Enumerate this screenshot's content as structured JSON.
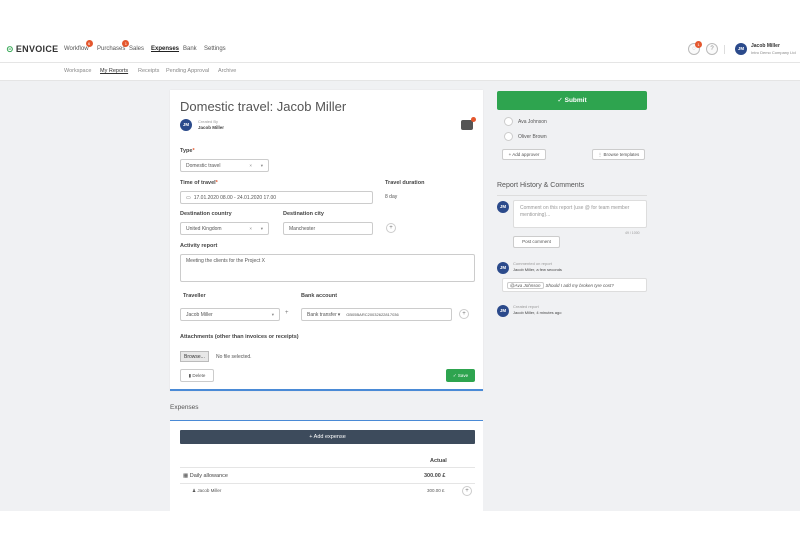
{
  "app": {
    "logo": "ENVOICE",
    "nav": [
      {
        "label": "Workflow",
        "badge": "6"
      },
      {
        "label": "Purchases",
        "badge": "1"
      },
      {
        "label": "Sales",
        "badge": ""
      },
      {
        "label": "Expenses",
        "badge": ""
      },
      {
        "label": "Bank",
        "badge": ""
      },
      {
        "label": "Settings",
        "badge": ""
      }
    ],
    "notif_count": "1",
    "help_icon": "?",
    "user": {
      "initials": "JM",
      "name": "Jacob Miller",
      "company": "Intro Demo Company Ltd"
    }
  },
  "subnav": [
    "Workspace",
    "My Reports",
    "Receipts",
    "Pending Approval",
    "Archive"
  ],
  "report": {
    "title": "Domestic travel: Jacob Miller",
    "created_by_label": "Created By",
    "created_by": "Jacob Miller",
    "author_initials": "JM",
    "type_label": "Type",
    "type_value": "Domestic travel",
    "time_label": "Time of travel",
    "time_value": "17.01.2020 08.00 - 24.01.2020 17.00",
    "duration_label": "Travel duration",
    "duration_value": "8 day",
    "country_label": "Destination country",
    "country_value": "United Kingdom",
    "city_label": "Destination city",
    "city_value": "Manchester",
    "activity_label": "Activity report",
    "activity_value": "Meeting the clients for the Project X",
    "traveller_label": "Traveller",
    "traveller_value": "Jacob Miller",
    "bank_label": "Bank account",
    "bank_method": "Bank transfer",
    "bank_iban": "GB05BARC20032622817036",
    "attachments_label": "Attachments (other than invoices or receipts)",
    "browse_label": "Browse...",
    "no_file": "No file selected.",
    "delete_label": "Delete",
    "save_label": "✓ Save",
    "dropdown_clear": "×",
    "dropdown_arrow": "▾",
    "plus": "+"
  },
  "sidebar": {
    "submit_label": "✓ Submit",
    "approvers": [
      "Ava Johnson",
      "Oliver Brown"
    ],
    "add_approver": "+ Add approver",
    "browse_templates": "⋮ Browse templates",
    "history_title": "Report History & Comments",
    "comment_placeholder": "Comment on this report (use @ for team member mentioning)...",
    "char_count": "49 / 1000",
    "post_label": "Post comment",
    "history": [
      {
        "initials": "JM",
        "action": "Commented on report",
        "who": "Jacob Miller, a few seconds"
      },
      {
        "initials": "JM",
        "action": "Created report",
        "who": "Jacob Miller, 4 minutes ago"
      }
    ],
    "comment_mention": "@Ava Johnson",
    "comment_text": "Should I add my broken tyre cost?"
  },
  "expenses": {
    "title": "Expenses",
    "add_label": "+ Add expense",
    "col_actual": "Actual",
    "rows": [
      {
        "label": "Daily allowance",
        "value": "300.00 £"
      },
      {
        "label": "Jacob Miller",
        "value": "300.00 £"
      }
    ]
  },
  "colors": {
    "accent": "#2ea44f",
    "brand_blue": "#2b4a8b",
    "badge": "#e4572e",
    "dark_button": "#3d4b5c"
  }
}
